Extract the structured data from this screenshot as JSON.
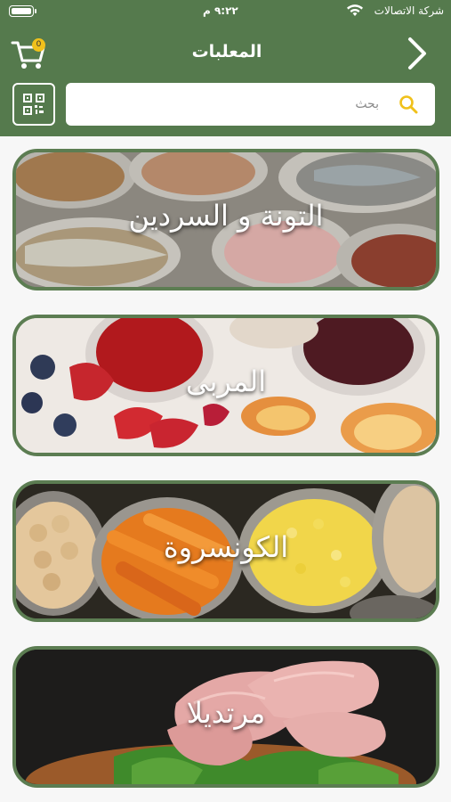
{
  "status_bar": {
    "carrier": "شركة الاتصالات",
    "time": "٩:٢٢ م"
  },
  "header": {
    "title": "المعلبات",
    "cart_count": "0"
  },
  "search": {
    "placeholder": "بحث"
  },
  "categories": [
    {
      "label": "التونة و السردين"
    },
    {
      "label": "المربى"
    },
    {
      "label": "الكونسروة"
    },
    {
      "label": "مرتديلا"
    }
  ],
  "colors": {
    "header": "#557a4d",
    "card_border": "#5c7d52",
    "badge": "#f0c11b",
    "search_icon": "#f0c11b"
  }
}
